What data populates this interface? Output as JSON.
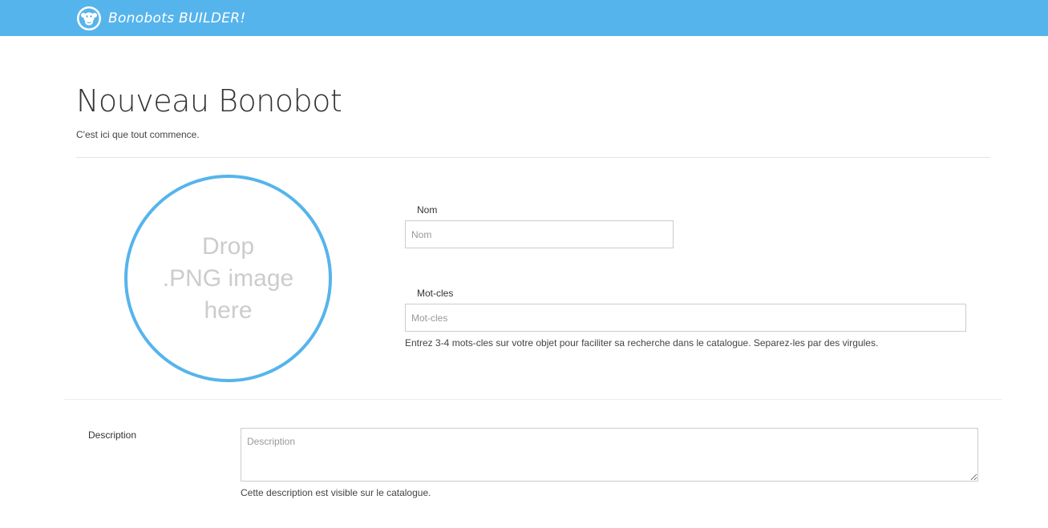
{
  "navbar": {
    "brand_name": "Bonobots BUILDER!",
    "brand_icon": "monkey-logo-icon",
    "color": "#56b4ec"
  },
  "header": {
    "title": "Nouveau Bonobot",
    "subtitle": "C'est ici que tout commence."
  },
  "dropzone": {
    "text": "Drop\n.PNG image\nhere",
    "border_color": "#56b4ec"
  },
  "form": {
    "nom": {
      "label": "Nom",
      "placeholder": "Nom",
      "value": ""
    },
    "motcles": {
      "label": "Mot-cles",
      "placeholder": "Mot-cles",
      "value": "",
      "help": "Entrez 3-4 mots-cles sur votre objet pour faciliter sa recherche dans le catalogue. Separez-les par des virgules."
    },
    "description": {
      "label": "Description",
      "placeholder": "Description",
      "value": "",
      "help": "Cette description est visible sur le catalogue."
    }
  }
}
